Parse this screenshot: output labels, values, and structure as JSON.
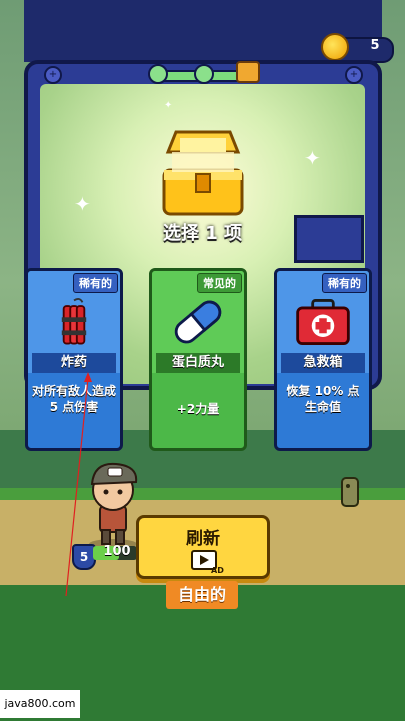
{
  "hud": {
    "coin_count": "5",
    "coin_icon": "coin-icon"
  },
  "reward": {
    "title_prefix": "选择",
    "title_number": "1",
    "title_suffix": "项"
  },
  "cards": [
    {
      "rarity": "稀有的",
      "name": "炸药",
      "icon": "dynamite-icon",
      "desc_parts": [
        "对所有敌人造成",
        "5",
        "点伤害"
      ],
      "color": "blue"
    },
    {
      "rarity": "常见的",
      "name": "蛋白质丸",
      "icon": "pill-icon",
      "desc_parts": [
        "+2",
        "力量"
      ],
      "color": "green"
    },
    {
      "rarity": "稀有的",
      "name": "急救箱",
      "icon": "first-aid-kit-icon",
      "desc_parts": [
        "恢复",
        "10%",
        "点生命值"
      ],
      "color": "blue"
    }
  ],
  "player": {
    "level": "5",
    "hp": "100",
    "hp_fraction": 0.6
  },
  "buttons": {
    "refresh_label": "刷新",
    "refresh_ad_tag": "AD",
    "free_label": "自由的"
  },
  "watermark": "java800.com",
  "colors": {
    "card_blue": "#2e7ad6",
    "card_green": "#4cb848",
    "button_yellow": "#ffd640",
    "free_orange": "#f08a24"
  }
}
